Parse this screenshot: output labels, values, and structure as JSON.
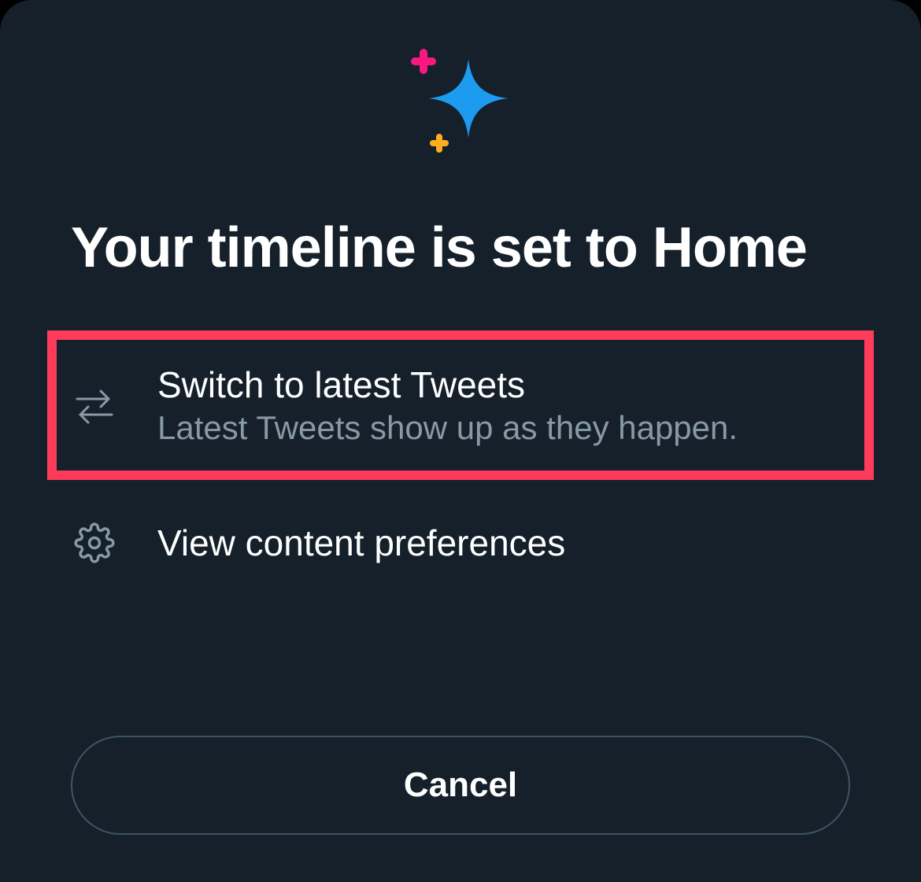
{
  "title": "Your timeline is set to Home",
  "options": {
    "switch": {
      "title": "Switch to latest Tweets",
      "subtitle": "Latest Tweets show up as they happen."
    },
    "preferences": {
      "title": "View content preferences"
    }
  },
  "cancel_label": "Cancel"
}
